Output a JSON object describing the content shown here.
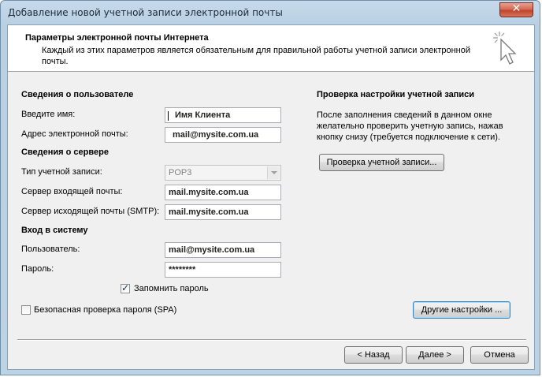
{
  "window": {
    "title": "Добавление новой учетной записи электронной почты",
    "close_glyph": "✕"
  },
  "header": {
    "title": "Параметры электронной почты Интернета",
    "description": "Каждый из этих параметров является обязательным для правильной работы учетной записи электронной почты."
  },
  "user_info": {
    "section_title": "Сведения о пользователе",
    "name_label": "Введите имя:",
    "name_value": "Имя Клиента",
    "email_label": "Адрес электронной почты:",
    "email_value": "mail@mysite.com.ua"
  },
  "server_info": {
    "section_title": "Сведения о сервере",
    "account_type_label": "Тип учетной записи:",
    "account_type_value": "POP3",
    "incoming_label": "Сервер входящей почты:",
    "incoming_value": "mail.mysite.com.ua",
    "outgoing_label": "Сервер исходящей почты (SMTP):",
    "outgoing_value": "mail.mysite.com.ua"
  },
  "logon": {
    "section_title": "Вход в систему",
    "user_label": "Пользователь:",
    "user_value": "mail@mysite.com.ua",
    "password_label": "Пароль:",
    "password_value": "********",
    "remember_label": "Запомнить пароль",
    "remember_checked": true,
    "spa_label": "Безопасная проверка пароля (SPA)",
    "spa_checked": false
  },
  "test": {
    "section_title": "Проверка настройки учетной записи",
    "description": "После заполнения сведений в данном окне желательно проверить учетную запись, нажав кнопку снизу (требуется подключение к сети).",
    "test_button": "Проверка учетной записи...",
    "more_settings_button": "Другие настройки ..."
  },
  "footer": {
    "back_button": "< Назад",
    "next_button": "Далее >",
    "cancel_button": "Отмена"
  },
  "icons": {
    "wizard": "cursor-click-icon",
    "close": "close-icon",
    "dropdown": "chevron-down-icon"
  },
  "colors": {
    "titlebar": "#c6daea",
    "client_bg": "#f0f0f0",
    "close_button": "#c2442c",
    "focus_border": "#3c7fb1"
  }
}
